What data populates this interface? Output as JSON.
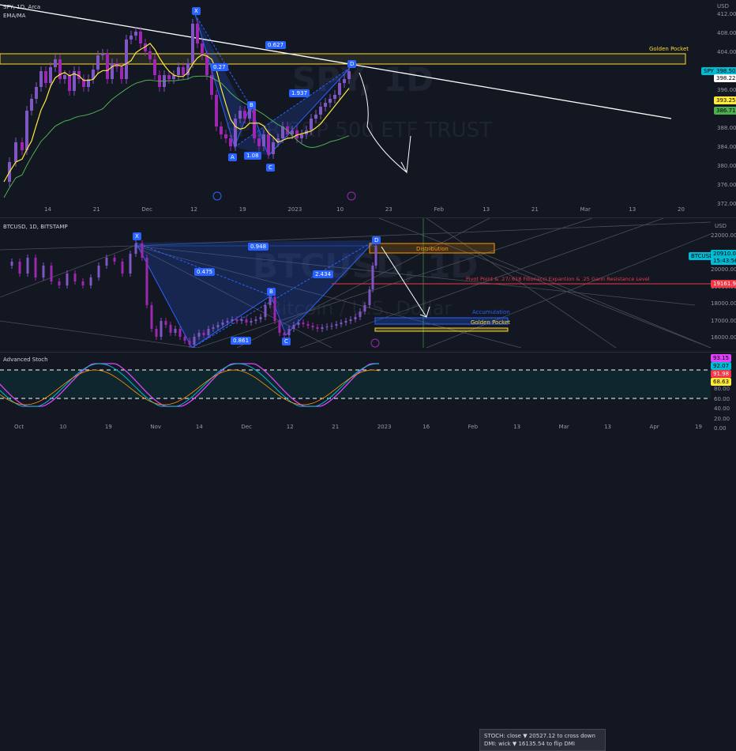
{
  "top": {
    "symbol_line": "SPY, 1D, Arca",
    "indicator_line": "EMA/MA",
    "watermark_ticker": "SPY, 1D",
    "watermark_name": "SPDR S&P 500 ETF TRUST",
    "golden_pocket": "Golden Pocket",
    "currency": "USD",
    "price_axis": [
      "412.00",
      "408.00",
      "404.00",
      "400.00",
      "396.00",
      "392.00",
      "388.00",
      "384.00",
      "380.00",
      "376.00",
      "372.00",
      "368.00"
    ],
    "date_axis": [
      "14",
      "21",
      "Dec",
      "12",
      "19",
      "2023",
      "10",
      "23",
      "Feb",
      "13",
      "21",
      "Mar",
      "13",
      "20"
    ],
    "pattern_labels": {
      "x": "X",
      "a": "A",
      "b": "B",
      "c": "C",
      "d": "D"
    },
    "ratios": {
      "xb": "0.627",
      "ad": "1.937",
      "bc": "1.08",
      "xa_ret": "0.27"
    },
    "price_tags": {
      "spy_name": "SPY",
      "spy_price": "398.50",
      "spy_prev": "398.22",
      "ema": "393.25",
      "ma": "386.71"
    }
  },
  "bottom": {
    "symbol_line": "BTCUSD, 1D, BITSTAMP",
    "watermark_ticker": "BTCUSD, 1D",
    "watermark_name": "Bitcoin / U.S. Dollar",
    "currency": "USD",
    "price_axis": [
      "22000.00",
      "21000.00",
      "20000.00",
      "19000.00",
      "18000.00",
      "17000.00",
      "16000.00"
    ],
    "date_axis": [
      "Oct",
      "10",
      "19",
      "Nov",
      "14",
      "Dec",
      "12",
      "21",
      "2023",
      "16",
      "Feb",
      "13",
      "Mar",
      "13",
      "Apr",
      "19"
    ],
    "distribution": "Distribution",
    "accumulation": "Accumulation",
    "golden_pocket": "Golden Pocket",
    "pivot_text": "Pivot Point & .27/.618 Fibonacci Expantion & .25 Gann Resistance Level",
    "pivot_price": "19161.93",
    "pattern_labels": {
      "x": "X",
      "a": "A",
      "b": "B",
      "c": "C",
      "d": "D"
    },
    "ratios": {
      "xb": "0.948",
      "xa": "0.475",
      "ad": "2.434",
      "bc": "0.861"
    },
    "price_tags": {
      "name": "BTCUSD",
      "price": "20910.00",
      "countdown": "15:43:56"
    }
  },
  "stoch": {
    "title": "Advanced Stoch",
    "info_line1": "STOCH: close ▼ 20527.12 to cross down",
    "info_line2": "DMI: wick ▼ 16135.54 to flip DMI",
    "axis": [
      "100.00",
      "80.00",
      "60.00",
      "40.00",
      "20.00",
      "0.00"
    ],
    "tags": [
      "93.15",
      "92.07",
      "91.98",
      "68.63"
    ],
    "date_axis": [
      "Oct",
      "10",
      "19",
      "Nov",
      "14",
      "Dec",
      "12",
      "21",
      "2023",
      "16",
      "Feb",
      "13",
      "Mar",
      "13",
      "Apr",
      "19"
    ]
  },
  "colors": {
    "up": "#7e57c2",
    "down": "#9c27b0",
    "ema": "#ffeb3b",
    "ma": "#4caf50",
    "pivot": "#f23645",
    "pattern": "#2962ff"
  }
}
